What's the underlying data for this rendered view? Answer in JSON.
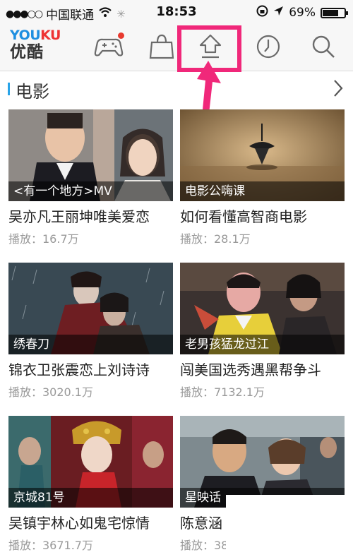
{
  "status_bar": {
    "carrier": "中国联通",
    "time": "18:53",
    "battery": "69%",
    "battery_level": 0.69
  },
  "navbar": {
    "logo_en": "YOUKU",
    "logo_cn": "优酷",
    "icons": [
      "game-icon",
      "shopping-bag-icon",
      "upload-icon",
      "history-clock-icon",
      "search-icon"
    ]
  },
  "section": {
    "title": "电影"
  },
  "videos": [
    {
      "caption": "<有一个地方>MV",
      "title": "吴亦凡王丽坤唯美爱恋",
      "plays": "播放：16.7万"
    },
    {
      "caption": "电影公嗨课",
      "title": "如何看懂高智商电影",
      "plays": "播放：28.1万"
    },
    {
      "caption": "绣春刀",
      "title": "锦衣卫张震恋上刘诗诗",
      "plays": "播放：3020.1万"
    },
    {
      "caption": "老男孩猛龙过江",
      "title": "闯美国选秀遇黑帮争斗",
      "plays": "播放：7132.1万"
    },
    {
      "caption": "京城81号",
      "title": "吴镇宇林心如鬼宅惊情",
      "plays": "播放：3671.7万"
    },
    {
      "caption": "星映话",
      "title": "陈意涵",
      "plays": "播放：38"
    }
  ],
  "colors": {
    "accent_blue": "#2aa4e8",
    "annotation_pink": "#f0287a",
    "badge_red": "#e83a2f"
  }
}
